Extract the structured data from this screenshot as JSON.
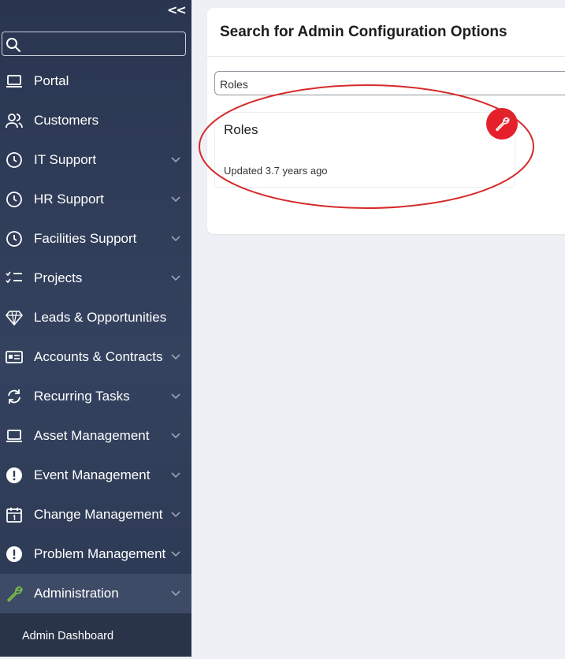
{
  "sidebar": {
    "collapse_label": "<<",
    "search": {
      "placeholder": "",
      "value": ""
    },
    "items": [
      {
        "label": "Portal",
        "icon": "laptop-icon",
        "expandable": false
      },
      {
        "label": "Customers",
        "icon": "users-icon",
        "expandable": false
      },
      {
        "label": "IT Support",
        "icon": "clock-icon",
        "expandable": true
      },
      {
        "label": "HR Support",
        "icon": "clock-icon",
        "expandable": true
      },
      {
        "label": "Facilities Support",
        "icon": "clock-icon",
        "expandable": true
      },
      {
        "label": "Projects",
        "icon": "checklist-icon",
        "expandable": true
      },
      {
        "label": "Leads & Opportunities",
        "icon": "diamond-icon",
        "expandable": false
      },
      {
        "label": "Accounts & Contracts",
        "icon": "id-card-icon",
        "expandable": true
      },
      {
        "label": "Recurring Tasks",
        "icon": "refresh-icon",
        "expandable": true
      },
      {
        "label": "Asset Management",
        "icon": "laptop-icon",
        "expandable": true
      },
      {
        "label": "Event Management",
        "icon": "alert-circle-icon",
        "expandable": true
      },
      {
        "label": "Change Management",
        "icon": "calendar-icon",
        "expandable": true
      },
      {
        "label": "Problem Management",
        "icon": "alert-circle-icon",
        "expandable": true
      },
      {
        "label": "Administration",
        "icon": "wrench-icon",
        "expandable": true,
        "active": true
      }
    ],
    "sub_items": [
      {
        "label": "Admin Dashboard"
      }
    ]
  },
  "main": {
    "title": "Search for Admin Configuration Options",
    "search": {
      "value": "Roles",
      "placeholder": ""
    },
    "results": [
      {
        "title": "Roles",
        "meta": "Updated 3.7 years ago",
        "icon": "wrench-icon"
      }
    ]
  },
  "colors": {
    "sidebar_bg": "#2f3b55",
    "accent_red": "#e5202a",
    "admin_icon": "#7cc14a",
    "annotation": "#d62b2b"
  }
}
